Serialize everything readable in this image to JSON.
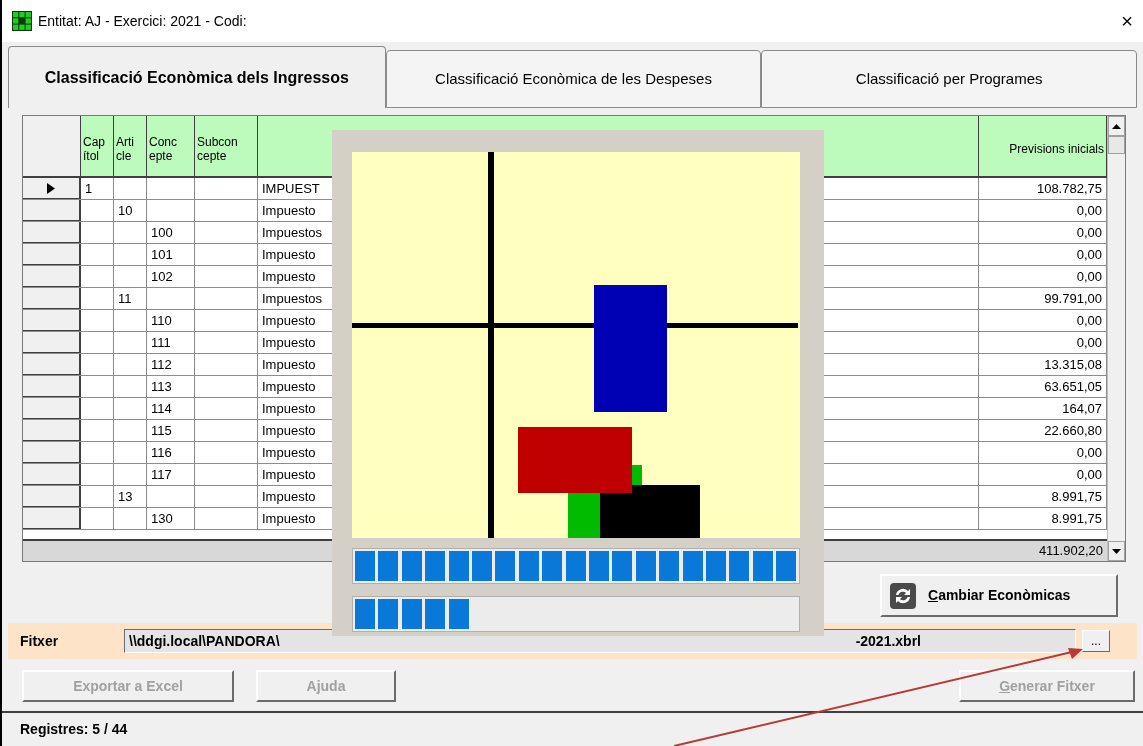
{
  "window": {
    "title": "Entitat: AJ - Exercici: 2021 - Codi:",
    "close": "×"
  },
  "tabs": [
    {
      "label": "Classificació Econòmica dels Ingressos",
      "selected": true
    },
    {
      "label": "Classificació Econòmica de les Despeses",
      "selected": false
    },
    {
      "label": "Classificació per Programes",
      "selected": false
    }
  ],
  "table": {
    "columns": [
      "Cap ítol",
      "Arti cle",
      "Conc epte",
      "Subcon cepte",
      "",
      "Previsions inicials"
    ],
    "rows": [
      {
        "selected": true,
        "capitol": "1",
        "article": "",
        "concepte": "",
        "subconcepte": "",
        "description": "IMPUEST",
        "previsions": "108.782,75"
      },
      {
        "selected": false,
        "capitol": "",
        "article": "10",
        "concepte": "",
        "subconcepte": "",
        "description": "Impuesto",
        "previsions": "0,00"
      },
      {
        "selected": false,
        "capitol": "",
        "article": "",
        "concepte": "100",
        "subconcepte": "",
        "description": "Impuestos",
        "previsions": "0,00"
      },
      {
        "selected": false,
        "capitol": "",
        "article": "",
        "concepte": "101",
        "subconcepte": "",
        "description": "Impuesto",
        "previsions": "0,00"
      },
      {
        "selected": false,
        "capitol": "",
        "article": "",
        "concepte": "102",
        "subconcepte": "",
        "description": "Impuesto",
        "previsions": "0,00"
      },
      {
        "selected": false,
        "capitol": "",
        "article": "11",
        "concepte": "",
        "subconcepte": "",
        "description": "Impuestos",
        "previsions": "99.791,00"
      },
      {
        "selected": false,
        "capitol": "",
        "article": "",
        "concepte": "110",
        "subconcepte": "",
        "description": "Impuesto",
        "previsions": "0,00"
      },
      {
        "selected": false,
        "capitol": "",
        "article": "",
        "concepte": "111",
        "subconcepte": "",
        "description": "Impuesto",
        "previsions": "0,00"
      },
      {
        "selected": false,
        "capitol": "",
        "article": "",
        "concepte": "112",
        "subconcepte": "",
        "description": "Impuesto",
        "previsions": "13.315,08"
      },
      {
        "selected": false,
        "capitol": "",
        "article": "",
        "concepte": "113",
        "subconcepte": "",
        "description": "Impuesto",
        "previsions": "63.651,05"
      },
      {
        "selected": false,
        "capitol": "",
        "article": "",
        "concepte": "114",
        "subconcepte": "",
        "description": "Impuesto",
        "previsions": "164,07"
      },
      {
        "selected": false,
        "capitol": "",
        "article": "",
        "concepte": "115",
        "subconcepte": "",
        "description": "Impuesto",
        "previsions": "22.660,80"
      },
      {
        "selected": false,
        "capitol": "",
        "article": "",
        "concepte": "116",
        "subconcepte": "",
        "description": "Impuesto",
        "previsions": "0,00"
      },
      {
        "selected": false,
        "capitol": "",
        "article": "",
        "concepte": "117",
        "subconcepte": "",
        "description": "Impuesto",
        "previsions": "0,00"
      },
      {
        "selected": false,
        "capitol": "",
        "article": "13",
        "concepte": "",
        "subconcepte": "",
        "description": "Impuesto",
        "previsions": "8.991,75"
      },
      {
        "selected": false,
        "capitol": "",
        "article": "",
        "concepte": "130",
        "subconcepte": "",
        "description": "Impuesto",
        "previsions": "8.991,75"
      }
    ],
    "total": "411.902,20"
  },
  "buttons_top": [
    {
      "label": "Cambiar Econòmicas",
      "disabled": false,
      "mnemonic": true
    }
  ],
  "file_field": {
    "label": "Fitxer",
    "value_start": "\\\\ddgi.local\\PANDORA\\",
    "value_end": "-2021.xbrl",
    "browse": "..."
  },
  "buttons": [
    {
      "label": "Exportar a Excel",
      "disabled": true,
      "mnemonic": false
    },
    {
      "label": "Ajuda",
      "disabled": true,
      "mnemonic": false
    },
    {
      "label": "Generar Fitxer",
      "disabled": true,
      "mnemonic": true
    }
  ],
  "progress_dialog": {
    "bars": [
      {
        "level": 1.0
      },
      {
        "level": 0.26
      }
    ]
  },
  "status_bar": "Registres: 5 / 44"
}
